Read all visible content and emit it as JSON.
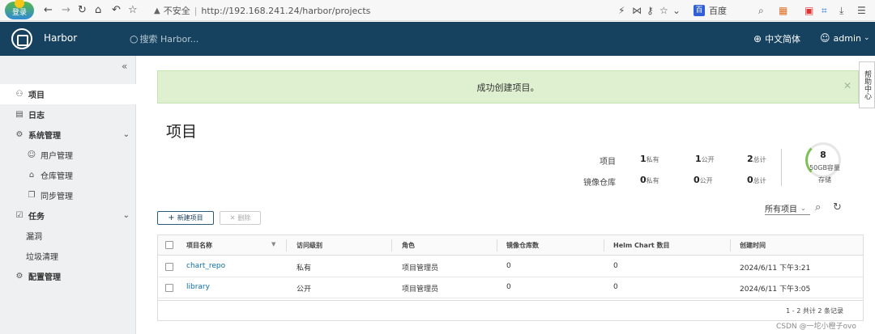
{
  "browser": {
    "login_badge": "登录",
    "insecure_label": "不安全",
    "url": "http://192.168.241.24/harbor/projects",
    "search_engine": "百度"
  },
  "header": {
    "brand": "Harbor",
    "search_placeholder": "搜索 Harbor...",
    "language": "中文简体",
    "user": "admin"
  },
  "sidebar": {
    "items": [
      {
        "label": "项目",
        "icon": "projects-icon"
      },
      {
        "label": "日志",
        "icon": "logs-icon"
      },
      {
        "label": "系统管理",
        "icon": "admin-icon"
      },
      {
        "label": "用户管理",
        "icon": "users-icon"
      },
      {
        "label": "仓库管理",
        "icon": "registry-icon"
      },
      {
        "label": "同步管理",
        "icon": "replication-icon"
      },
      {
        "label": "任务",
        "icon": "tasks-icon"
      },
      {
        "label": "漏洞",
        "icon": ""
      },
      {
        "label": "垃圾清理",
        "icon": ""
      },
      {
        "label": "配置管理",
        "icon": "config-icon"
      }
    ]
  },
  "banner": {
    "message": "成功创建项目。"
  },
  "side_tab": "帮助中心",
  "page_title": "项目",
  "stats": {
    "row_labels": [
      "项目",
      "镜像仓库"
    ],
    "projects": {
      "private": "1",
      "public": "1",
      "total": "2"
    },
    "repos": {
      "private": "0",
      "public": "0",
      "total": "0"
    },
    "unit_private": "私有",
    "unit_public": "公开",
    "unit_total": "总计",
    "storage_count": "8",
    "storage_capacity": "50GB容量",
    "storage_label": "存储"
  },
  "toolbar": {
    "new_project": "新建项目",
    "delete": "删除",
    "filter": "所有项目"
  },
  "table": {
    "headers": [
      "项目名称",
      "访问级别",
      "角色",
      "镜像仓库数",
      "Helm Chart 数目",
      "创建时间"
    ],
    "rows": [
      {
        "name": "chart_repo",
        "access": "私有",
        "role": "项目管理员",
        "repos": "0",
        "charts": "0",
        "created": "2024/6/11 下午3:21"
      },
      {
        "name": "library",
        "access": "公开",
        "role": "项目管理员",
        "repos": "0",
        "charts": "0",
        "created": "2024/6/11 下午3:05"
      }
    ],
    "pagination": "1 - 2 共计 2 条记录"
  },
  "watermark": "CSDN @一坨小橙子ovo",
  "colors": {
    "header": "#17425f",
    "banner": "#dff0d0",
    "link": "#0a6fb0"
  }
}
